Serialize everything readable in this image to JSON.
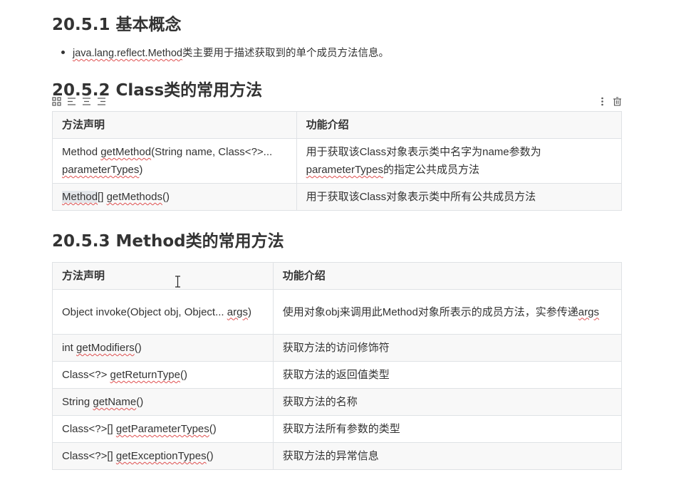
{
  "section1": {
    "heading": "20.5.1 基本概念",
    "bullet_link": "java.lang.reflect.Method",
    "bullet_rest": "类主要用于描述获取到的单个成员方法信息。"
  },
  "section2": {
    "heading": "20.5.2 Class类的常用方法",
    "table": {
      "headers": [
        "方法声明",
        "功能介绍"
      ],
      "rows": [
        {
          "c1a": "Method ",
          "c1b": "getMethod",
          "c1c": "(String  name, Class<?>... ",
          "c1d": "parameterTypes",
          "c1e": ")",
          "c2a": "用于获取该Class对象表示类中名字为name参数为",
          "c2b": "parameterTypes",
          "c2c": "的指定公共成员方法"
        },
        {
          "c1a": "Method",
          "c1b": "[] ",
          "c1c": "getMethods",
          "c1d": "()",
          "c2": "用于获取该Class对象表示类中所有公共成员方法"
        }
      ]
    }
  },
  "section3": {
    "heading": "20.5.3 Method类的常用方法",
    "table": {
      "headers": [
        "方法声明",
        "功能介绍"
      ],
      "rows": [
        {
          "c1a": "Object invoke(Object obj,  Object... ",
          "c1b": "args",
          "c1c": ")",
          "c2a": "使用对象obj来调用此Method对象所表示的成员方法，实参传递",
          "c2b": "args"
        },
        {
          "c1a": "int ",
          "c1b": "getModifiers",
          "c1c": "()",
          "c2": "获取方法的访问修饰符"
        },
        {
          "c1a": "Class<?> ",
          "c1b": "getReturnType",
          "c1c": "()",
          "c2": "获取方法的返回值类型"
        },
        {
          "c1a": "String ",
          "c1b": "getName",
          "c1c": "()",
          "c2": "获取方法的名称"
        },
        {
          "c1a": "Class<?>[] ",
          "c1b": "getParameterTypes",
          "c1c": "()",
          "c2": "获取方法所有参数的类型"
        },
        {
          "c1a": "Class<?>[] ",
          "c1b": "getExceptionTypes",
          "c1c": "()",
          "c2": "获取方法的异常信息"
        }
      ]
    }
  },
  "toolbar": {
    "left_icons": [
      "grid-icon",
      "align-left-icon",
      "align-center-icon",
      "align-right-icon"
    ],
    "right_icons": [
      "more-vertical-icon",
      "trash-icon"
    ]
  },
  "colors": {
    "text": "#333333",
    "border": "#dfe2e5",
    "header_bg": "#f8f8f8",
    "spell_underline": "#e05050",
    "selection": "#e3e6ea"
  }
}
